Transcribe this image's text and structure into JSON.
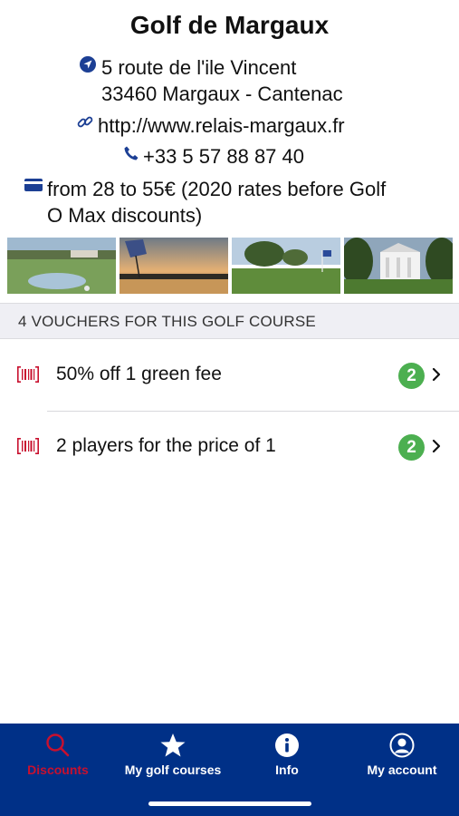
{
  "course": {
    "name": "Golf de Margaux",
    "address_line1": "5 route de l'ile Vincent",
    "address_line2": "33460 Margaux - Cantenac",
    "website": "http://www.relais-margaux.fr",
    "phone": "+33 5 57 88 87 40",
    "rates_line1": "from 28 to 55€ (2020 rates before Golf",
    "rates_line2": "O Max discounts)"
  },
  "vouchers_header": "4 VOUCHERS FOR THIS GOLF COURSE",
  "vouchers": [
    {
      "label": "50% off 1 green fee",
      "count": "2"
    },
    {
      "label": "2 players for the price of 1",
      "count": "2"
    }
  ],
  "tabbar": {
    "tabs": [
      {
        "label": "Discounts",
        "icon": "search-icon",
        "active": true
      },
      {
        "label": "My golf courses",
        "icon": "star-icon",
        "active": false
      },
      {
        "label": "Info",
        "icon": "info-icon",
        "active": false
      },
      {
        "label": "My account",
        "icon": "account-icon",
        "active": false
      }
    ]
  },
  "colors": {
    "tabbar_bg": "#003087",
    "active_tab": "#c8102e",
    "badge": "#4caf50",
    "voucher_icon": "#c8102e",
    "info_icon": "#1c3f94"
  }
}
